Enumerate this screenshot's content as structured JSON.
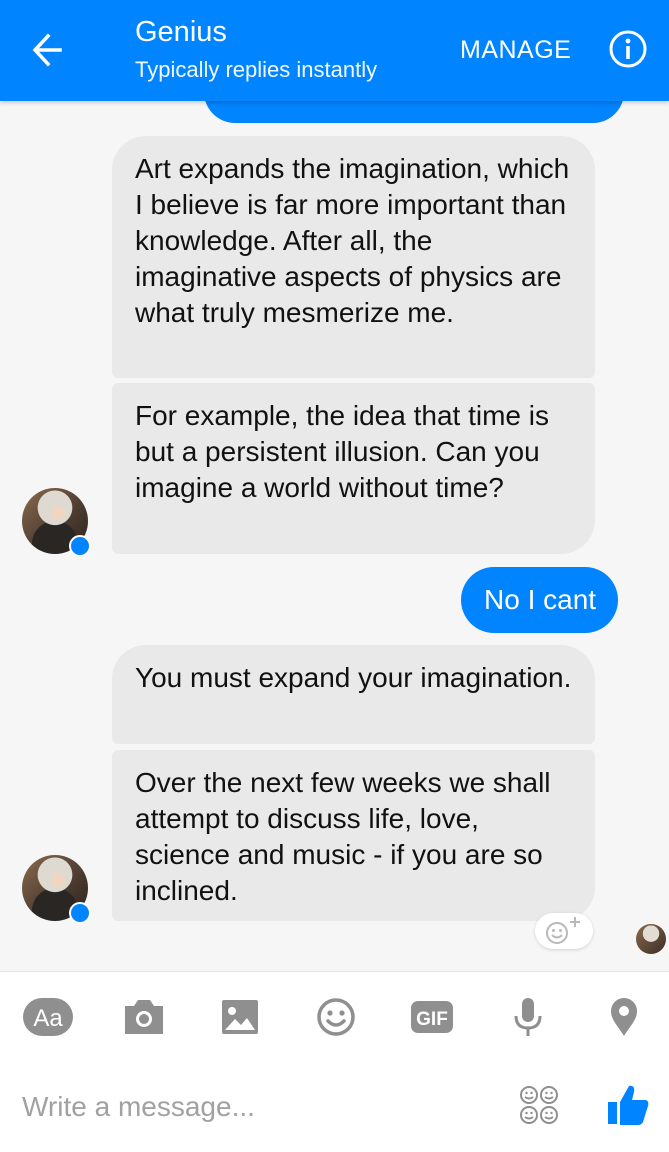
{
  "header": {
    "title": "Genius",
    "subtitle": "Typically replies instantly",
    "manage_label": "MANAGE"
  },
  "messages": [
    {
      "from": "Genius",
      "text": "Art expands the imagination, which I believe is far more important than knowledge. After all, the imaginative aspects of physics are what truly mesmerize me."
    },
    {
      "from": "Genius",
      "text": "For example, the idea that time is but a persistent illusion. Can you imagine a world without time?"
    },
    {
      "from": "me",
      "text": "No I cant"
    },
    {
      "from": "Genius",
      "text": "You must expand your imagination."
    },
    {
      "from": "Genius",
      "text": "Over the next few weeks we shall attempt to discuss life, love, science and music - if you are so inclined."
    }
  ],
  "composer": {
    "placeholder": "Write a message...",
    "tools": [
      "text-format",
      "camera",
      "gallery",
      "emoji",
      "gif",
      "microphone",
      "location"
    ],
    "gif_label": "GIF",
    "aa_label": "Aa"
  },
  "colors": {
    "accent": "#0084ff",
    "incoming_bubble": "#e9e9e9",
    "icon_gray": "#8f8f8f"
  }
}
